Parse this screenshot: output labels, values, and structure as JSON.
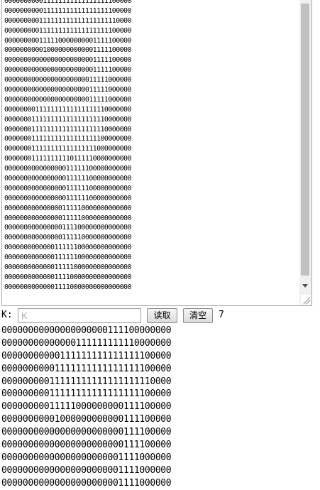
{
  "textarea": {
    "lines": [
      "000000000011111111111111111100000",
      "000000000011111111111111111100000",
      "000000000111111111111111111110000",
      "000000000111111111111111111100000",
      "000000000111110000000001111100000",
      "000000000010000000000001111100000",
      "000000000000000000000001111100000",
      "000000000000000000000001111100000",
      "000000000000000000000011111000000",
      "000000000000000000000011111000000",
      "000000000000000000000011111000000",
      "000000001111111111111111110000000",
      "000000011111111111111111110000000",
      "000000011111111111111111110000000",
      "000000011111111111111111100000000",
      "000000011111111111111111000000000",
      "000000011111111110111110000000000",
      "000000000000000011111100000000000",
      "000000000000000011111100000000000",
      "000000000000000011111100000000000",
      "000000000000000011111100000000000",
      "000000000000000111110000000000000",
      "000000000000000111110000000000000",
      "000000000000000111100000000000000",
      "000000000000000111110000000000000",
      "000000000000011111100000000000000",
      "000000000000011111100000000000000",
      "000000000000011111000000000000000",
      "000000000000011110000000000000000",
      "000000000000011110000000000000000"
    ]
  },
  "controls": {
    "k_label": "K:",
    "k_placeholder": "K",
    "k_value": "",
    "read_button": "读取",
    "clear_button": "清空",
    "count": "7"
  },
  "output": {
    "lines": [
      "00000000000000000000111100000000",
      "00000000000000111111111110000000",
      "00000000000111111111111111100000",
      "00000000001111111111111111100000",
      "00000000011111111111111111110000",
      "00000000011111111111111111100000",
      "00000000011111000000000111100000",
      "00000000001000000000000111100000",
      "00000000000000000000000111100000",
      "00000000000000000000000111100000",
      "00000000000000000000001111000000",
      "00000000000000000000001111000000",
      "00000000000000000000001111000000"
    ]
  },
  "icons": {
    "scroll_down": "arrow-down-icon",
    "resize": "resize-grip-icon"
  }
}
